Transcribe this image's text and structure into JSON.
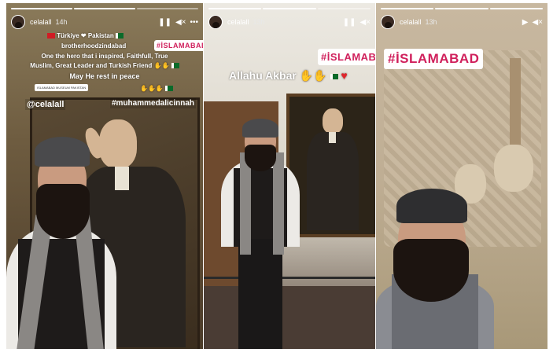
{
  "stories": [
    {
      "username": "celalall",
      "time": "14h",
      "controls": [
        "pause-icon",
        "mute-icon",
        "more-icon"
      ],
      "location_tag": "#İSLAMABAD",
      "caption_lines": [
        "Türkiye ❤ Pakistan",
        "brotherhoodzindabad",
        "One the hero that i inspired, Faithfull, True",
        "Muslim, Great Leader and Turkish Friend",
        "May He rest in peace"
      ],
      "pill_text": "ISLAMABAD MUSEUM PAKISTAN",
      "mention": "@celalall",
      "hashtag": "#muhammedalicinnah"
    },
    {
      "username": "celalall",
      "time": "13h",
      "controls": [
        "pause-icon",
        "mute-icon"
      ],
      "location_tag": "#İSLAMAB",
      "caption": "Allahu Akbar"
    },
    {
      "username": "celalall",
      "time": "13h",
      "controls": [
        "play-icon",
        "mute-icon"
      ],
      "location_tag": "#İSLAMABAD"
    }
  ],
  "colors": {
    "tag_text": "#d0205c",
    "heart": "#e0262c"
  }
}
